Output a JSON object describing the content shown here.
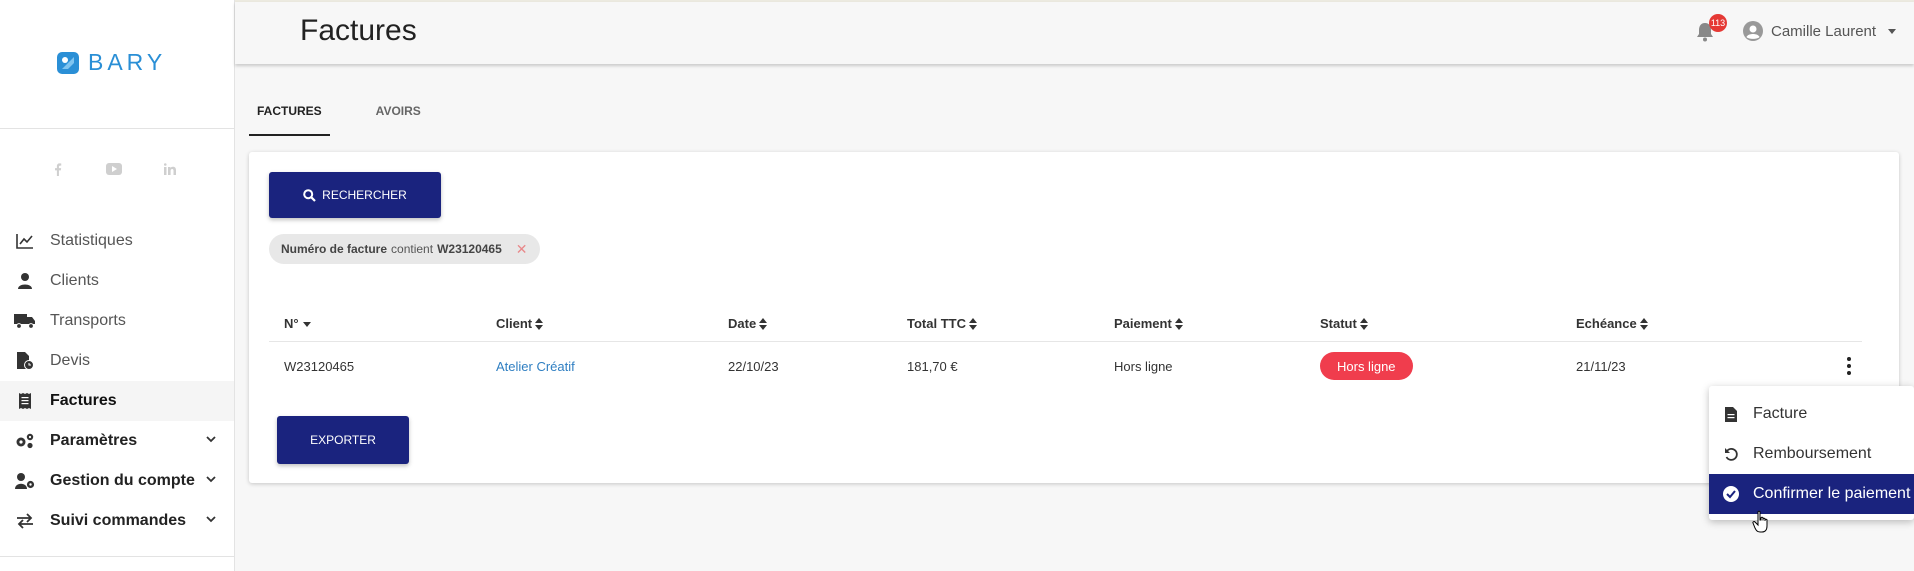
{
  "brand": {
    "name": "BARY",
    "color": "#2a8fd6"
  },
  "sidebar": {
    "socials": [
      "facebook-icon",
      "youtube-icon",
      "linkedin-icon"
    ],
    "items": [
      {
        "label": "Statistiques",
        "icon": "chart-line-icon"
      },
      {
        "label": "Clients",
        "icon": "user-icon"
      },
      {
        "label": "Transports",
        "icon": "truck-icon"
      },
      {
        "label": "Devis",
        "icon": "file-invoice-icon"
      },
      {
        "label": "Factures",
        "icon": "receipt-icon"
      },
      {
        "label": "Paramètres",
        "icon": "cogs-icon"
      },
      {
        "label": "Gestion du compte",
        "icon": "user-cog-icon"
      },
      {
        "label": "Suivi commandes",
        "icon": "exchange-icon"
      }
    ]
  },
  "header": {
    "title": "Factures",
    "notification_count": "113",
    "user_name": "Camille Laurent"
  },
  "tabs": [
    {
      "label": "FACTURES",
      "active": true
    },
    {
      "label": "AVOIRS",
      "active": false
    }
  ],
  "search": {
    "button_label": "RECHERCHER",
    "filter_chip": {
      "field": "Numéro de facture",
      "operator": "contient",
      "value": "W23120465"
    }
  },
  "table": {
    "columns": [
      "N°",
      "Client",
      "Date",
      "Total TTC",
      "Paiement",
      "Statut",
      "Echéance"
    ],
    "rows": [
      {
        "numero": "W23120465",
        "client": "Atelier Créatif",
        "date": "22/10/23",
        "total": "181,70 €",
        "paiement": "Hors ligne",
        "statut": "Hors ligne",
        "echeance": "21/11/23"
      }
    ]
  },
  "export_label": "EXPORTER",
  "row_menu": {
    "items": [
      {
        "label": "Facture",
        "icon": "file-icon"
      },
      {
        "label": "Remboursement",
        "icon": "undo-icon"
      },
      {
        "label": "Confirmer le paiement",
        "icon": "check-circle-icon"
      }
    ]
  },
  "colors": {
    "primary": "#1a237e",
    "status_offline": "#f03d4d",
    "link": "#2f7fc2"
  }
}
